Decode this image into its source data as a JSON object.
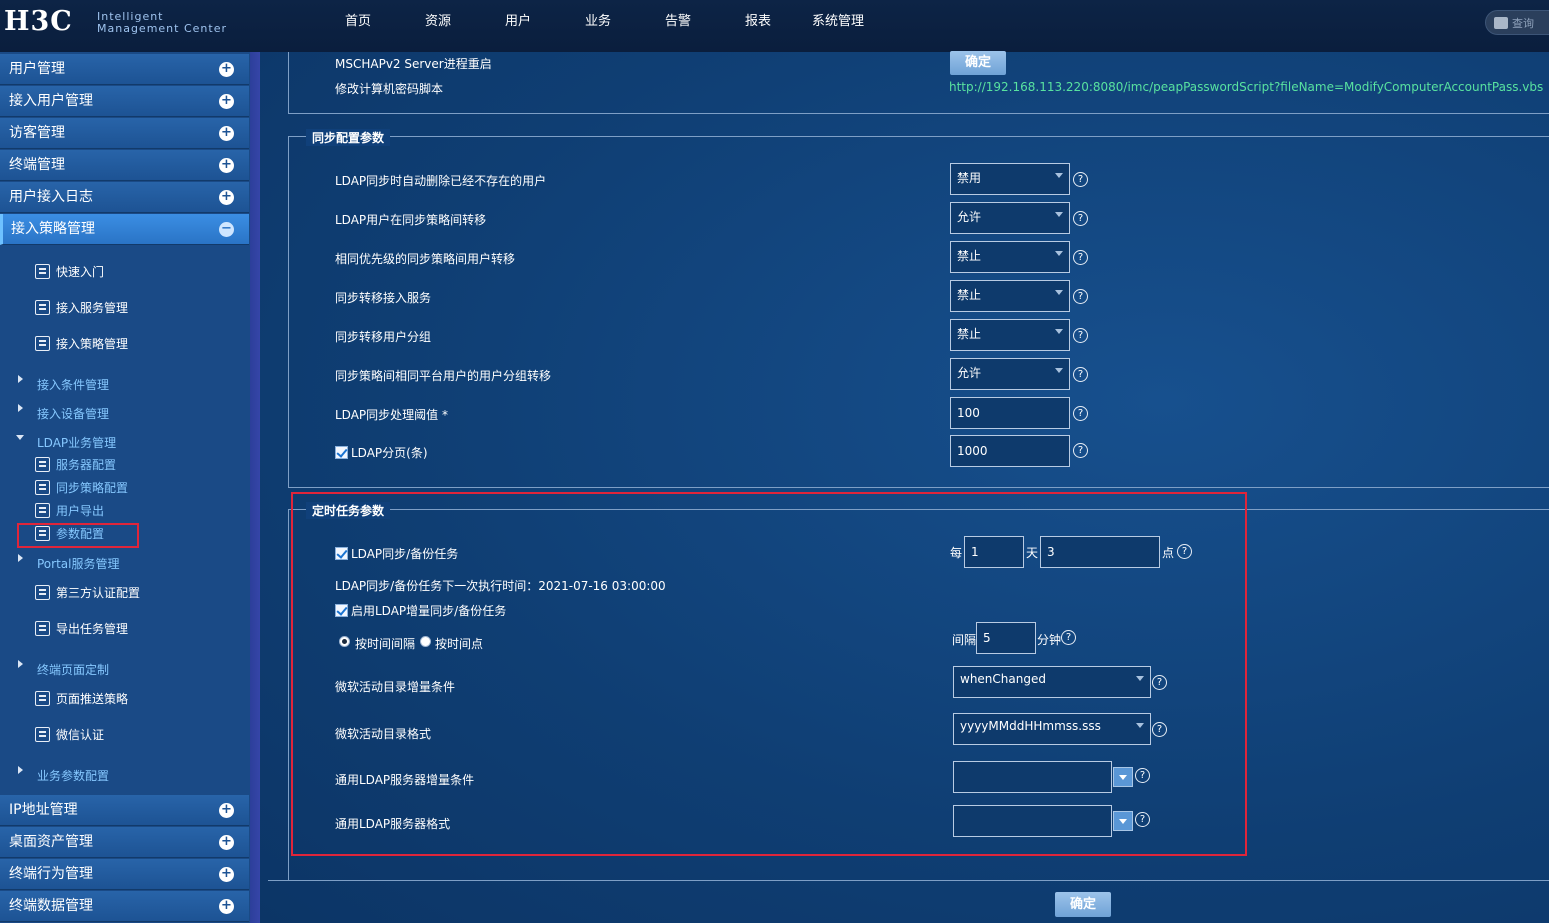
{
  "header": {
    "logo": "H3C",
    "logo_line1": "Intelligent",
    "logo_line2": "Management Center",
    "nav": [
      "首页",
      "资源",
      "用户",
      "业务",
      "告警",
      "报表",
      "系统管理"
    ],
    "search": "查询"
  },
  "sidebar": {
    "top_menus": [
      "用户管理",
      "接入用户管理",
      "访客管理",
      "终端管理",
      "用户接入日志",
      "接入策略管理"
    ],
    "top_sub": [
      "快速入门",
      "接入服务管理",
      "接入策略管理"
    ],
    "groups": {
      "cond": "接入条件管理",
      "device": "接入设备管理",
      "ldap": "LDAP业务管理",
      "ldap_items": [
        "服务器配置",
        "同步策略配置",
        "用户导出",
        "参数配置"
      ],
      "portal": "Portal服务管理",
      "third": "第三方认证配置",
      "export": "导出任务管理",
      "terminal_page": "终端页面定制",
      "push": "页面推送策略",
      "wechat": "微信认证",
      "biz": "业务参数配置"
    },
    "bottom_menus": [
      "IP地址管理",
      "桌面资产管理",
      "终端行为管理",
      "终端数据管理"
    ]
  },
  "top_section": {
    "mschap_label": "MSCHAPv2 Server进程重启",
    "confirm_btn": "确定",
    "script_label": "修改计算机密码脚本",
    "script_url": "http://192.168.113.220:8080/imc/peapPasswordScript?fileName=ModifyComputerAccountPass.vbs"
  },
  "sync_section": {
    "legend": "同步配置参数",
    "rows": [
      {
        "label": "LDAP同步时自动删除已经不存在的用户",
        "value": "禁用"
      },
      {
        "label": "LDAP用户在同步策略间转移",
        "value": "允许"
      },
      {
        "label": "相同优先级的同步策略间用户转移",
        "value": "禁止"
      },
      {
        "label": "同步转移接入服务",
        "value": "禁止"
      },
      {
        "label": "同步转移用户分组",
        "value": "禁止"
      },
      {
        "label": "同步策略间相同平台用户的用户分组转移",
        "value": "允许"
      }
    ],
    "threshold_label": "LDAP同步处理阈值",
    "required_mark": "*",
    "threshold_value": "100",
    "paging_label": "LDAP分页(条)",
    "paging_value": "1000"
  },
  "task_section": {
    "legend": "定时任务参数",
    "backup_label": "LDAP同步/备份任务",
    "every": "每",
    "days_value": "1",
    "day_unit": "天",
    "hour_value": "3",
    "hour_unit": "点",
    "next_time": "LDAP同步/备份任务下一次执行时间：2021-07-16 03:00:00",
    "incr_label": "启用LDAP增量同步/备份任务",
    "radio_interval": "按时间间隔",
    "radio_point": "按时间点",
    "interval_label": "间隔",
    "interval_value": "5",
    "minute_unit": "分钟",
    "ad_cond_label": "微软活动目录增量条件",
    "ad_cond_value": "whenChanged",
    "ad_fmt_label": "微软活动目录格式",
    "ad_fmt_value": "yyyyMMddHHmmss.sss",
    "ldap_cond_label": "通用LDAP服务器增量条件",
    "ldap_fmt_label": "通用LDAP服务器格式"
  },
  "footer": {
    "confirm_btn": "确定"
  }
}
